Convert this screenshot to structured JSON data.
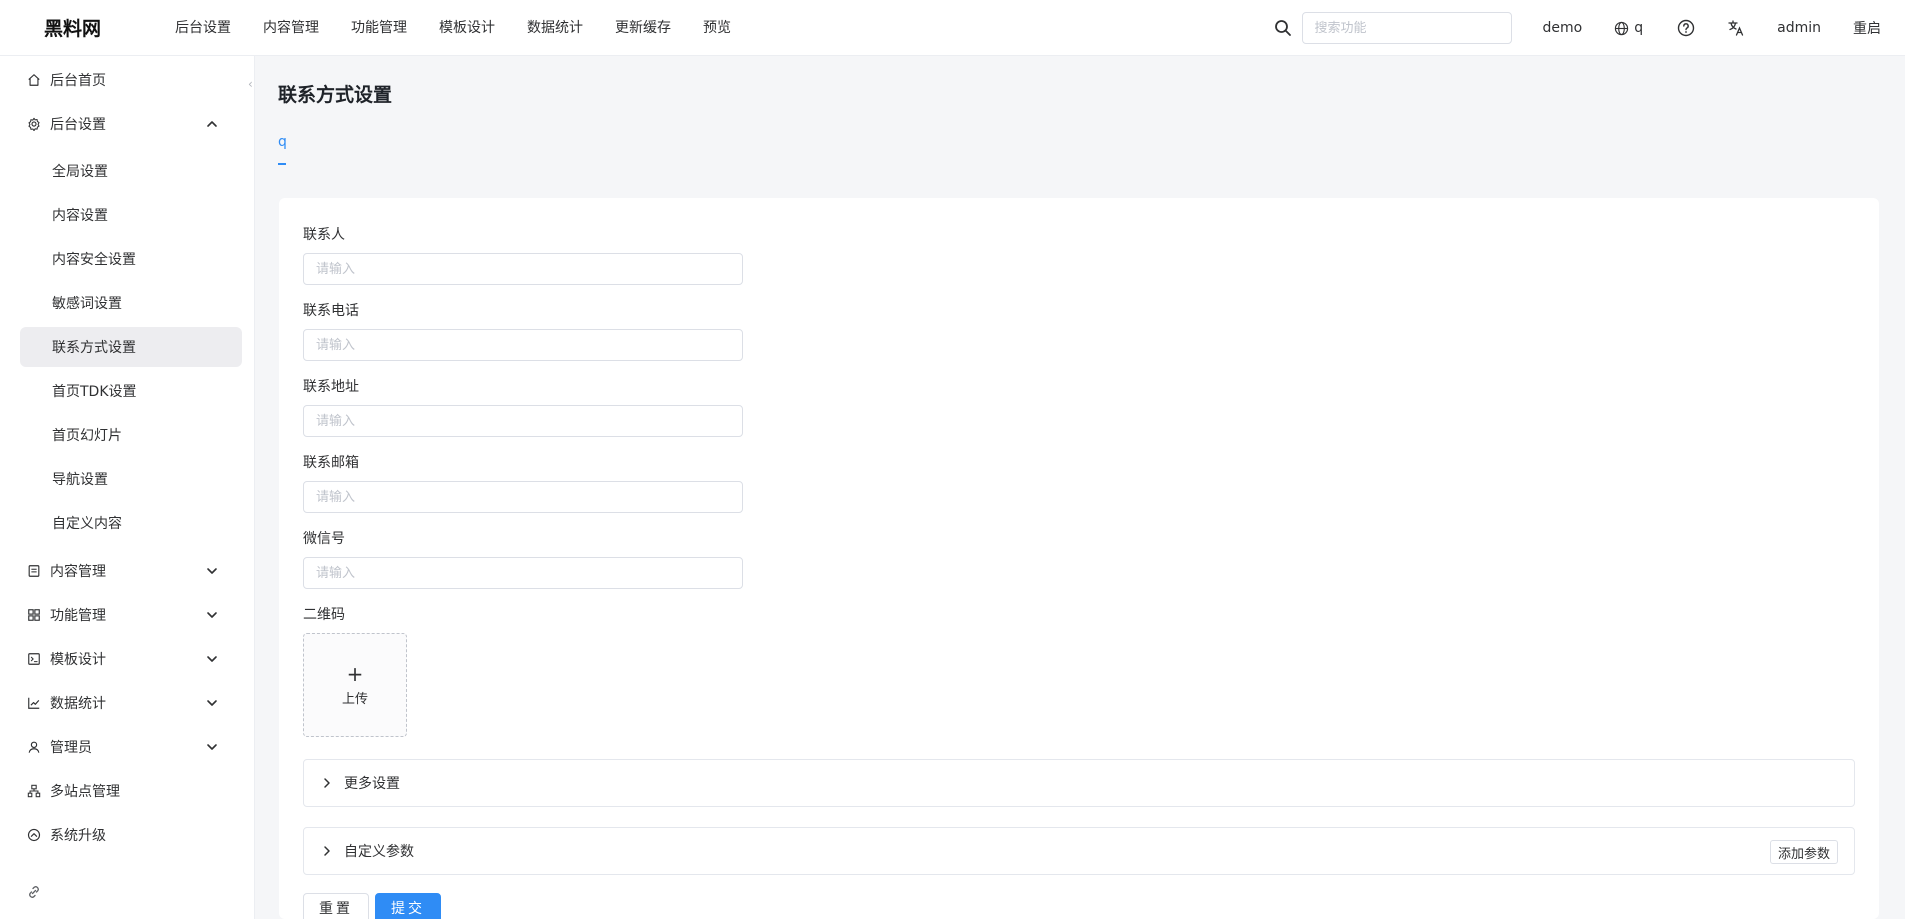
{
  "app": {
    "logo": "黑料网"
  },
  "topnav": [
    "后台设置",
    "内容管理",
    "功能管理",
    "模板设计",
    "数据统计",
    "更新缓存",
    "预览"
  ],
  "header": {
    "search_placeholder": "搜索功能",
    "site": "demo",
    "language": "q",
    "user": "admin",
    "restart": "重启"
  },
  "sidebar": {
    "home": "后台首页",
    "settings": "后台设置",
    "settings_sub": [
      "全局设置",
      "内容设置",
      "内容安全设置",
      "敏感词设置",
      "联系方式设置",
      "首页TDK设置",
      "首页幻灯片",
      "导航设置",
      "自定义内容"
    ],
    "content": "内容管理",
    "features": "功能管理",
    "templates": "模板设计",
    "stats": "数据统计",
    "admins": "管理员",
    "multisite": "多站点管理",
    "upgrade": "系统升级"
  },
  "page": {
    "title": "联系方式设置",
    "tab": "q"
  },
  "form": {
    "fields": [
      {
        "label": "联系人",
        "placeholder": "请输入"
      },
      {
        "label": "联系电话",
        "placeholder": "请输入"
      },
      {
        "label": "联系地址",
        "placeholder": "请输入"
      },
      {
        "label": "联系邮箱",
        "placeholder": "请输入"
      },
      {
        "label": "微信号",
        "placeholder": "请输入"
      }
    ],
    "qrcode_label": "二维码",
    "upload_label": "上传",
    "more_settings": "更多设置",
    "custom_params": "自定义参数",
    "add_param": "添加参数",
    "reset": "重置",
    "submit": "提交"
  },
  "colors": {
    "accent": "#2f8cf5",
    "active_bg": "#ededf0",
    "border": "#dcdfe6"
  }
}
